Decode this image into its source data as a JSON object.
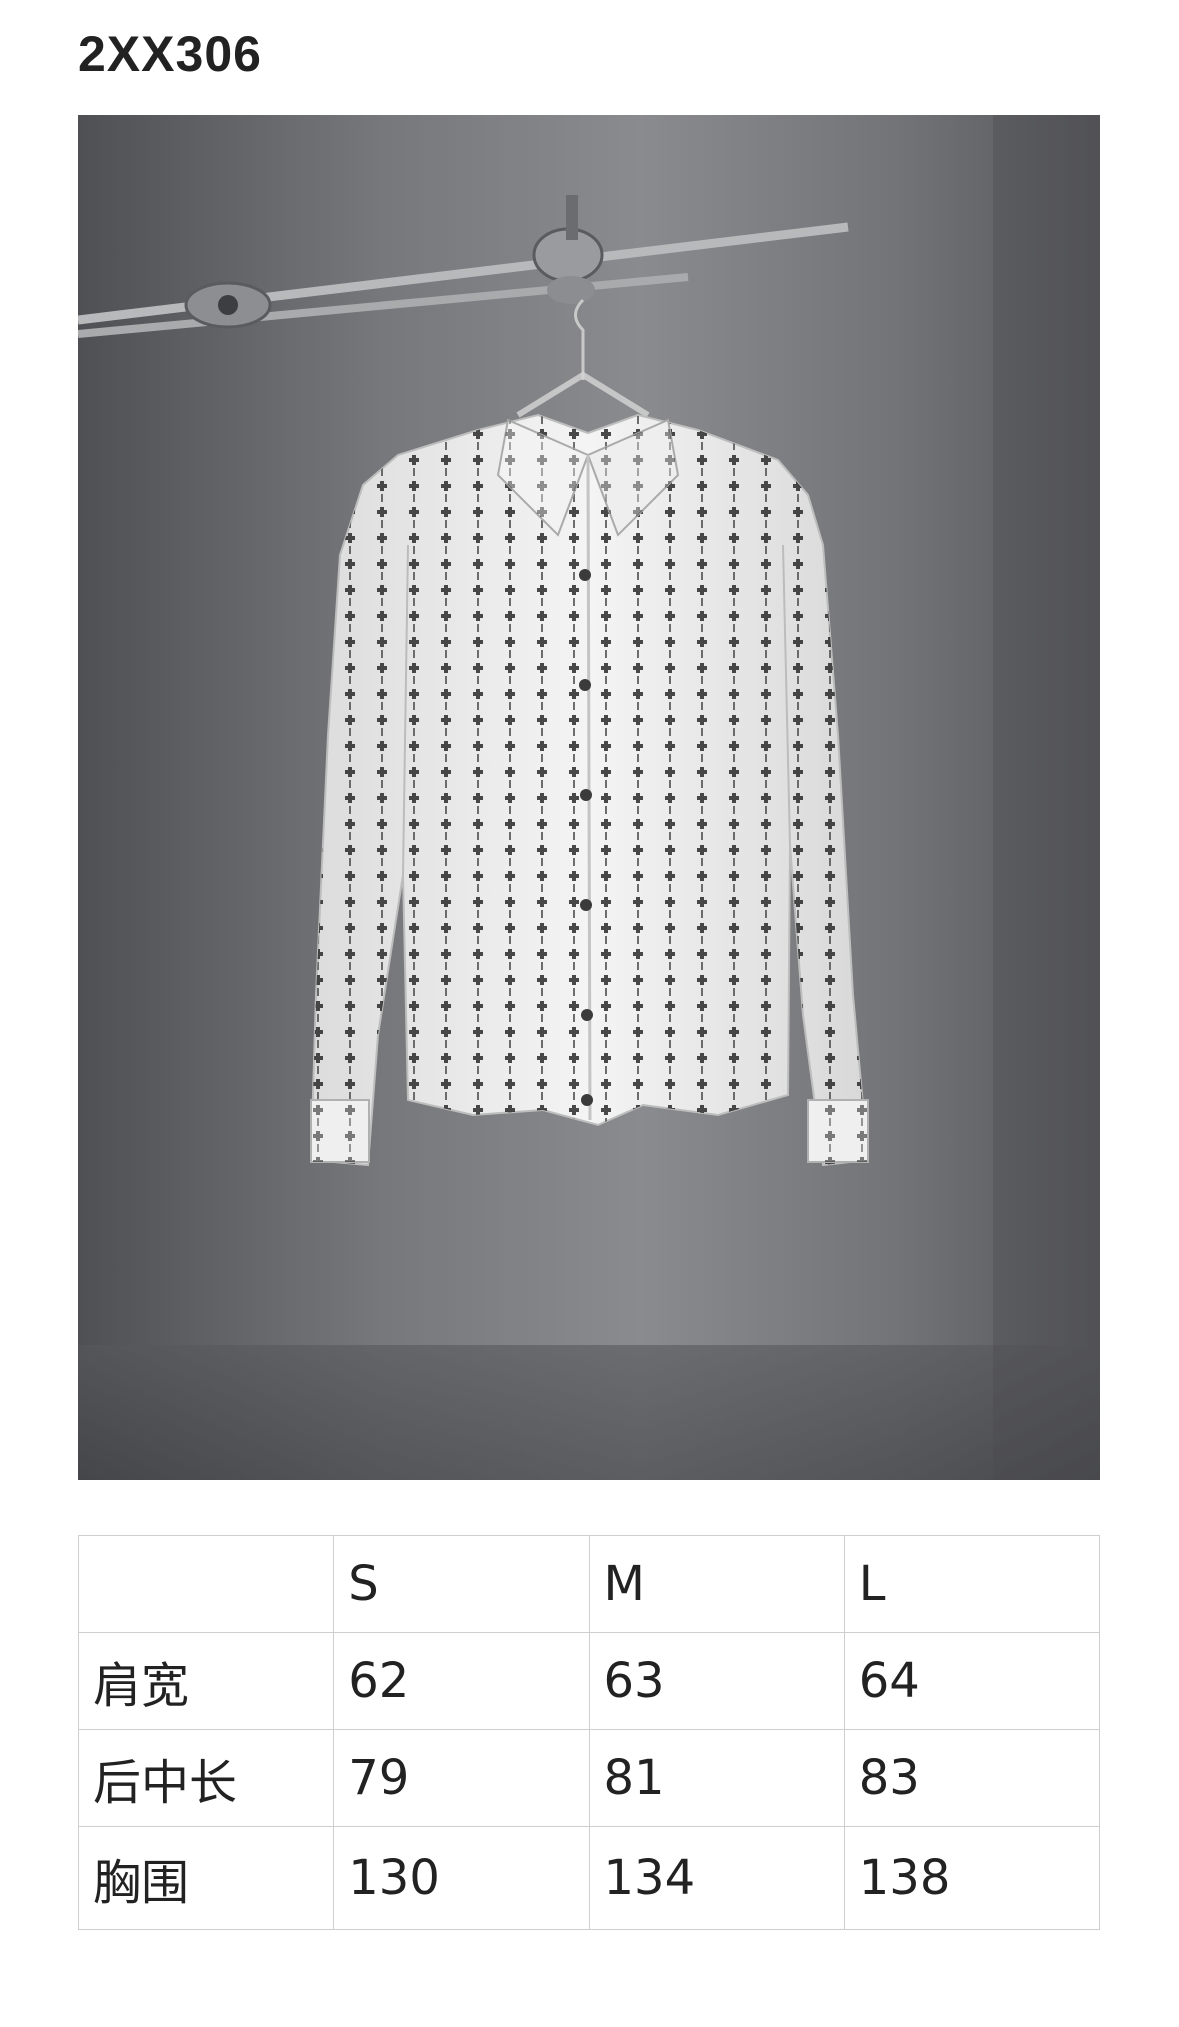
{
  "header": {
    "product_code": "2XX306"
  },
  "photo": {
    "subject": "shirt-photo"
  },
  "size_table": {
    "headers": [
      "",
      "S",
      "M",
      "L"
    ],
    "rows": [
      {
        "label": "肩宽",
        "values": [
          "62",
          "63",
          "64"
        ]
      },
      {
        "label": "后中长",
        "values": [
          "79",
          "81",
          "83"
        ]
      },
      {
        "label": "胸围",
        "values": [
          "130",
          "134",
          "138"
        ]
      }
    ]
  }
}
